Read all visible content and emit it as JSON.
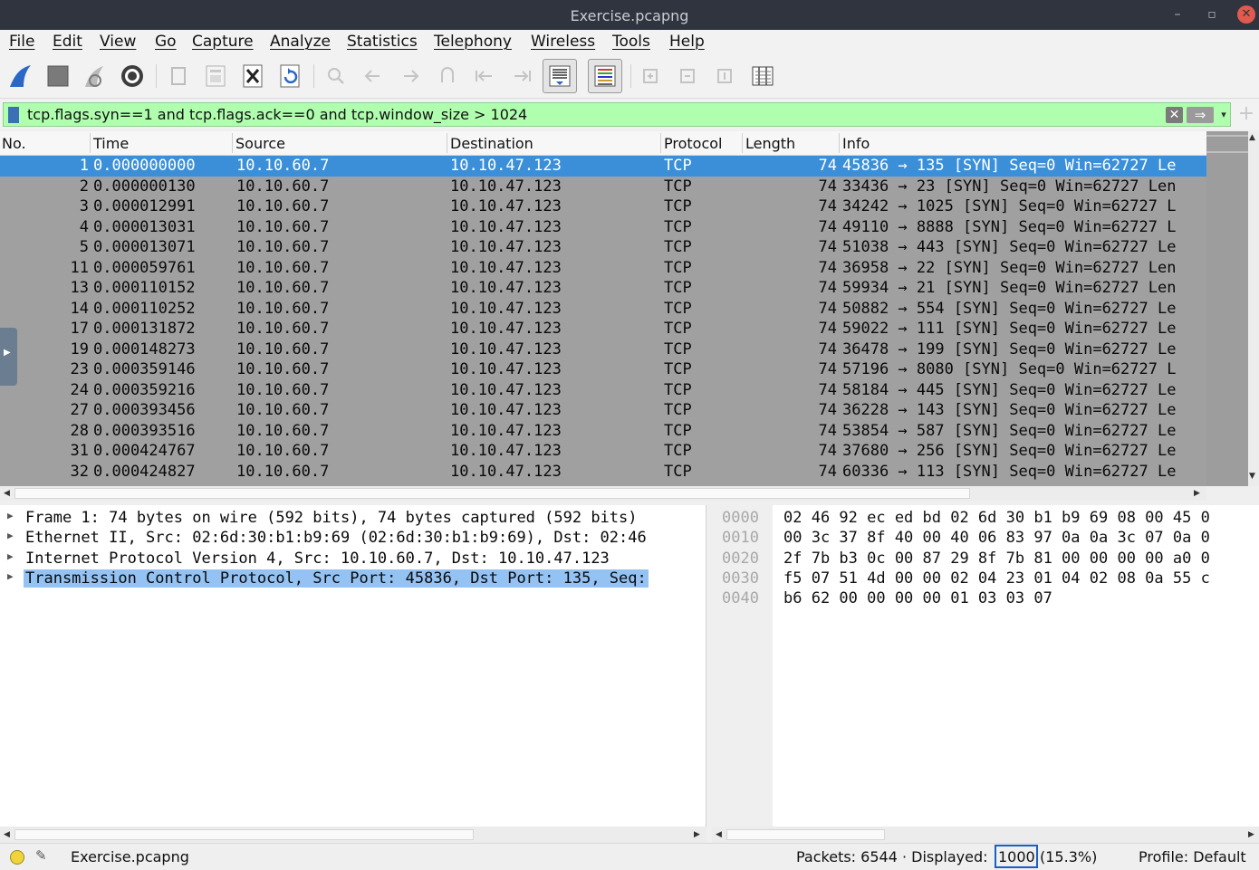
{
  "window": {
    "title": "Exercise.pcapng",
    "minimize": "–",
    "restore": "▫",
    "close": "✕"
  },
  "menu": [
    "File",
    "Edit",
    "View",
    "Go",
    "Capture",
    "Analyze",
    "Statistics",
    "Telephony",
    "Wireless",
    "Tools",
    "Help"
  ],
  "toolbar_icons": [
    "shark-fin-start-icon",
    "stop-capture-icon",
    "restart-capture-icon",
    "capture-options-icon",
    "open-file-icon",
    "save-file-icon",
    "close-file-icon",
    "reload-file-icon",
    "find-packet-icon",
    "go-back-icon",
    "go-forward-icon",
    "go-to-packet-icon",
    "first-packet-icon",
    "last-packet-icon",
    "autoscroll-icon",
    "colorize-icon",
    "zoom-in-icon",
    "zoom-out-icon",
    "normal-size-icon",
    "resize-columns-icon"
  ],
  "filter": {
    "value": "tcp.flags.syn==1 and tcp.flags.ack==0 and tcp.window_size > 1024",
    "clear": "✕",
    "apply": "⇒",
    "dropdown": "▾",
    "add": "+"
  },
  "columns": [
    "No.",
    "Time",
    "Source",
    "Destination",
    "Protocol",
    "Length",
    "Info"
  ],
  "packets": [
    {
      "no": "1",
      "time": "0.000000000",
      "src": "10.10.60.7",
      "dst": "10.10.47.123",
      "proto": "TCP",
      "len": "74",
      "info": "45836 → 135 [SYN] Seq=0 Win=62727 Le"
    },
    {
      "no": "2",
      "time": "0.000000130",
      "src": "10.10.60.7",
      "dst": "10.10.47.123",
      "proto": "TCP",
      "len": "74",
      "info": "33436 → 23 [SYN] Seq=0 Win=62727 Len"
    },
    {
      "no": "3",
      "time": "0.000012991",
      "src": "10.10.60.7",
      "dst": "10.10.47.123",
      "proto": "TCP",
      "len": "74",
      "info": "34242 → 1025 [SYN] Seq=0 Win=62727 L"
    },
    {
      "no": "4",
      "time": "0.000013031",
      "src": "10.10.60.7",
      "dst": "10.10.47.123",
      "proto": "TCP",
      "len": "74",
      "info": "49110 → 8888 [SYN] Seq=0 Win=62727 L"
    },
    {
      "no": "5",
      "time": "0.000013071",
      "src": "10.10.60.7",
      "dst": "10.10.47.123",
      "proto": "TCP",
      "len": "74",
      "info": "51038 → 443 [SYN] Seq=0 Win=62727 Le"
    },
    {
      "no": "11",
      "time": "0.000059761",
      "src": "10.10.60.7",
      "dst": "10.10.47.123",
      "proto": "TCP",
      "len": "74",
      "info": "36958 → 22 [SYN] Seq=0 Win=62727 Len"
    },
    {
      "no": "13",
      "time": "0.000110152",
      "src": "10.10.60.7",
      "dst": "10.10.47.123",
      "proto": "TCP",
      "len": "74",
      "info": "59934 → 21 [SYN] Seq=0 Win=62727 Len"
    },
    {
      "no": "14",
      "time": "0.000110252",
      "src": "10.10.60.7",
      "dst": "10.10.47.123",
      "proto": "TCP",
      "len": "74",
      "info": "50882 → 554 [SYN] Seq=0 Win=62727 Le"
    },
    {
      "no": "17",
      "time": "0.000131872",
      "src": "10.10.60.7",
      "dst": "10.10.47.123",
      "proto": "TCP",
      "len": "74",
      "info": "59022 → 111 [SYN] Seq=0 Win=62727 Le"
    },
    {
      "no": "19",
      "time": "0.000148273",
      "src": "10.10.60.7",
      "dst": "10.10.47.123",
      "proto": "TCP",
      "len": "74",
      "info": "36478 → 199 [SYN] Seq=0 Win=62727 Le"
    },
    {
      "no": "23",
      "time": "0.000359146",
      "src": "10.10.60.7",
      "dst": "10.10.47.123",
      "proto": "TCP",
      "len": "74",
      "info": "57196 → 8080 [SYN] Seq=0 Win=62727 L"
    },
    {
      "no": "24",
      "time": "0.000359216",
      "src": "10.10.60.7",
      "dst": "10.10.47.123",
      "proto": "TCP",
      "len": "74",
      "info": "58184 → 445 [SYN] Seq=0 Win=62727 Le"
    },
    {
      "no": "27",
      "time": "0.000393456",
      "src": "10.10.60.7",
      "dst": "10.10.47.123",
      "proto": "TCP",
      "len": "74",
      "info": "36228 → 143 [SYN] Seq=0 Win=62727 Le"
    },
    {
      "no": "28",
      "time": "0.000393516",
      "src": "10.10.60.7",
      "dst": "10.10.47.123",
      "proto": "TCP",
      "len": "74",
      "info": "53854 → 587 [SYN] Seq=0 Win=62727 Le"
    },
    {
      "no": "31",
      "time": "0.000424767",
      "src": "10.10.60.7",
      "dst": "10.10.47.123",
      "proto": "TCP",
      "len": "74",
      "info": "37680 → 256 [SYN] Seq=0 Win=62727 Le"
    },
    {
      "no": "32",
      "time": "0.000424827",
      "src": "10.10.60.7",
      "dst": "10.10.47.123",
      "proto": "TCP",
      "len": "74",
      "info": "60336 → 113 [SYN] Seq=0 Win=62727 Le"
    }
  ],
  "details": [
    "Frame 1: 74 bytes on wire (592 bits), 74 bytes captured (592 bits)",
    "Ethernet II, Src: 02:6d:30:b1:b9:69 (02:6d:30:b1:b9:69), Dst: 02:46",
    "Internet Protocol Version 4, Src: 10.10.60.7, Dst: 10.10.47.123",
    "Transmission Control Protocol, Src Port: 45836, Dst Port: 135, Seq:"
  ],
  "hex": [
    {
      "offset": "0000",
      "bytes": "02 46 92 ec ed bd 02 6d  30 b1 b9 69 08 00 45 0"
    },
    {
      "offset": "0010",
      "bytes": "00 3c 37 8f 40 00 40 06  83 97 0a 0a 3c 07 0a 0"
    },
    {
      "offset": "0020",
      "bytes": "2f 7b b3 0c 00 87 29 8f  7b 81 00 00 00 00 a0 0"
    },
    {
      "offset": "0030",
      "bytes": "f5 07 51 4d 00 00 02 04  23 01 04 02 08 0a 55 c"
    },
    {
      "offset": "0040",
      "bytes": "b6 62 00 00 00 00 01 03  03 07"
    }
  ],
  "status": {
    "file": "Exercise.pcapng",
    "packets_label": "Packets: 6544 · Displayed: ",
    "displayed": "1000",
    "percent": "(15.3%)",
    "profile": "Profile: Default"
  }
}
